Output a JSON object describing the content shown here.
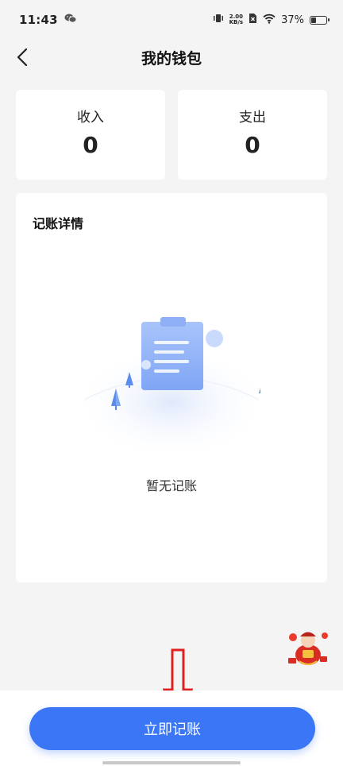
{
  "status_bar": {
    "time": "11:43",
    "net_speed_value": "2.00",
    "net_speed_unit": "KB/s",
    "battery_percent": "37%",
    "battery_level": 0.37
  },
  "nav": {
    "title": "我的钱包"
  },
  "summary": {
    "income_label": "收入",
    "income_value": "0",
    "expense_label": "支出",
    "expense_value": "0"
  },
  "details": {
    "heading": "记账详情",
    "empty_text": "暂无记账"
  },
  "action": {
    "button_label": "立即记账"
  },
  "colors": {
    "primary": "#3b76f6",
    "annotation": "#e02020",
    "background": "#f4f4f4"
  }
}
